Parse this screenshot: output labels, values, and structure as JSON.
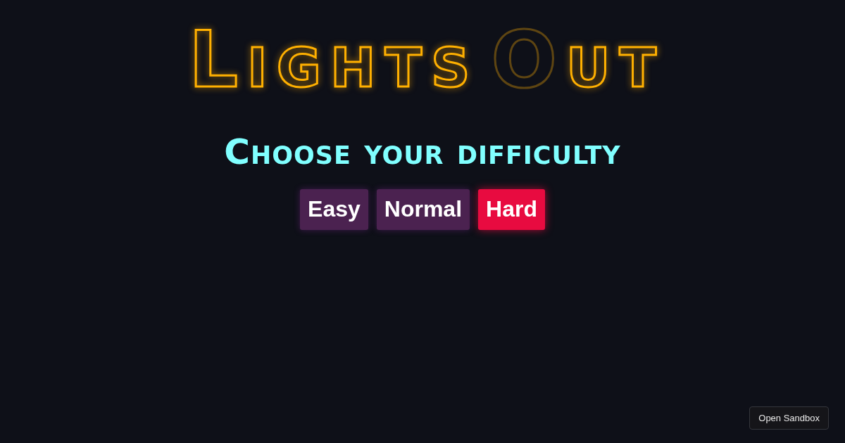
{
  "title": {
    "words": [
      {
        "letters": [
          {
            "char": "L",
            "lit": true
          },
          {
            "char": "i",
            "lit": true
          },
          {
            "char": "g",
            "lit": true
          },
          {
            "char": "h",
            "lit": true
          },
          {
            "char": "t",
            "lit": true
          },
          {
            "char": "s",
            "lit": true
          }
        ]
      },
      {
        "letters": [
          {
            "char": "O",
            "lit": false
          },
          {
            "char": "u",
            "lit": true
          },
          {
            "char": "t",
            "lit": true
          }
        ]
      }
    ]
  },
  "difficulty": {
    "heading": "Choose your difficulty",
    "options": [
      {
        "label": "Easy",
        "selected": false
      },
      {
        "label": "Normal",
        "selected": false
      },
      {
        "label": "Hard",
        "selected": true
      }
    ]
  },
  "sandbox_button": {
    "label": "Open Sandbox"
  }
}
